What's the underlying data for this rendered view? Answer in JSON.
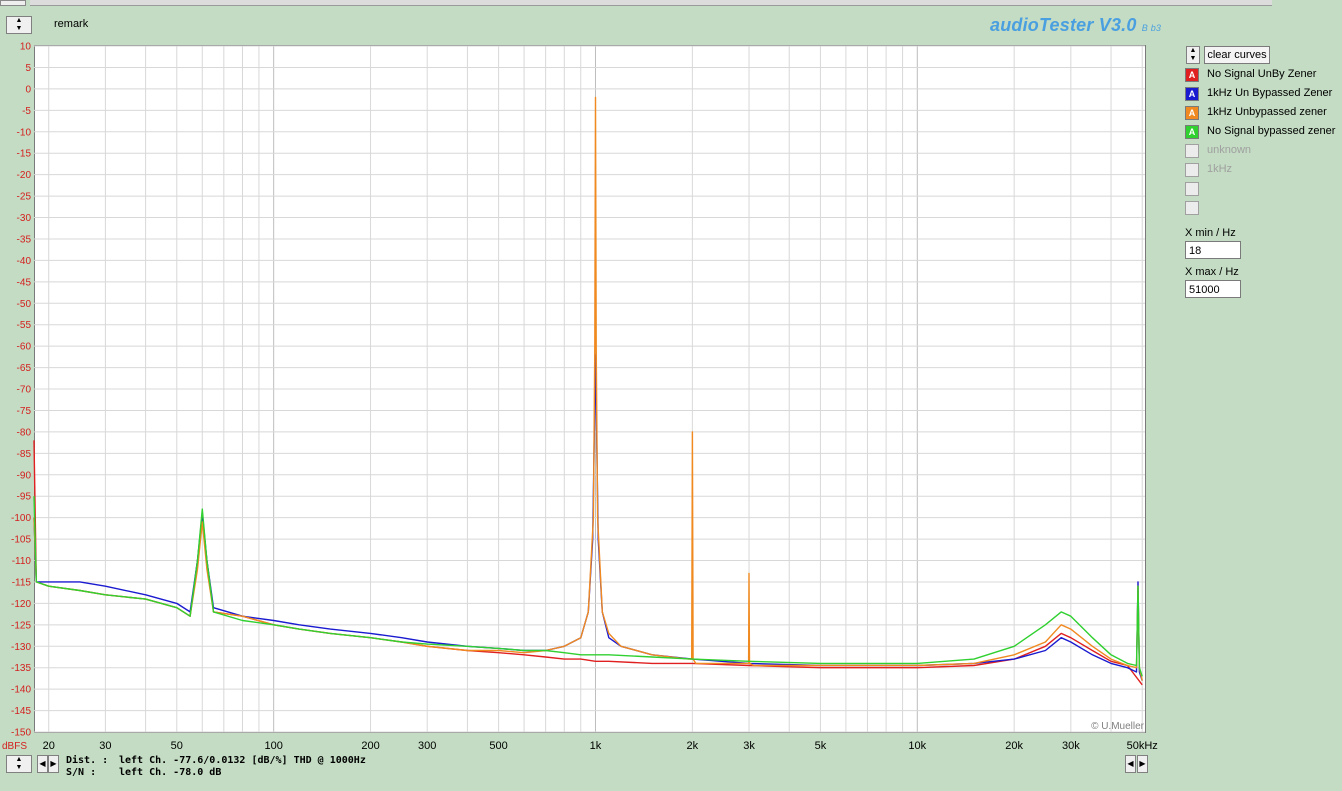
{
  "app": {
    "remark": "remark",
    "brand": "audioTester V3.0",
    "brand_suffix": "B b3",
    "watermark": "© U.Mueller"
  },
  "controls": {
    "clear_label": "clear curves",
    "legend": [
      {
        "label": "No Signal UnBy Zener",
        "color": "#e02020",
        "glyph": "A",
        "active": true
      },
      {
        "label": "1kHz Un Bypassed Zener",
        "color": "#1a1ad0",
        "glyph": "A",
        "active": true
      },
      {
        "label": "1kHz Unbypassed zener",
        "color": "#f08a20",
        "glyph": "A",
        "active": true
      },
      {
        "label": "No Signal bypassed zener",
        "color": "#30d030",
        "glyph": "A",
        "active": true
      },
      {
        "label": "unknown",
        "color": "",
        "glyph": "",
        "active": false
      },
      {
        "label": "1kHz",
        "color": "",
        "glyph": "",
        "active": false
      },
      {
        "label": "",
        "color": "",
        "glyph": "",
        "active": false
      },
      {
        "label": "",
        "color": "",
        "glyph": "",
        "active": false
      }
    ],
    "xmin_label": "X min / Hz",
    "xmin_value": "18",
    "xmax_label": "X max / Hz",
    "xmax_value": "51000"
  },
  "status": {
    "dist_key": "Dist. :",
    "dist_text": "left Ch. -77.6/0.0132 [dB/%] THD @ 1000Hz",
    "sn_key": "S/N :",
    "sn_text": "left Ch. -78.0 dB"
  },
  "chart_data": {
    "type": "line",
    "xscale": "log",
    "xlim": [
      18,
      51000
    ],
    "ylim": [
      -150,
      10
    ],
    "ylabel": "dBFS",
    "grid": true,
    "yticks": [
      "10",
      "5",
      "0",
      "-5",
      "-10",
      "-15",
      "-20",
      "-25",
      "-30",
      "-35",
      "-40",
      "-45",
      "-50",
      "-55",
      "-60",
      "-65",
      "-70",
      "-75",
      "-80",
      "-85",
      "-90",
      "-95",
      "-100",
      "-105",
      "-110",
      "-115",
      "-120",
      "-125",
      "-130",
      "-135",
      "-140",
      "-145",
      "-150"
    ],
    "xticks": [
      {
        "v": 20,
        "t": "20"
      },
      {
        "v": 30,
        "t": "30"
      },
      {
        "v": 50,
        "t": "50"
      },
      {
        "v": 100,
        "t": "100"
      },
      {
        "v": 200,
        "t": "200"
      },
      {
        "v": 300,
        "t": "300"
      },
      {
        "v": 500,
        "t": "500"
      },
      {
        "v": 1000,
        "t": "1k"
      },
      {
        "v": 2000,
        "t": "2k"
      },
      {
        "v": 3000,
        "t": "3k"
      },
      {
        "v": 5000,
        "t": "5k"
      },
      {
        "v": 10000,
        "t": "10k"
      },
      {
        "v": 20000,
        "t": "20k"
      },
      {
        "v": 30000,
        "t": "30k"
      },
      {
        "v": 50000,
        "t": "50kHz"
      }
    ],
    "series": [
      {
        "name": "No Signal UnBy Zener",
        "color": "#e02020",
        "x": [
          18,
          18.3,
          20,
          25,
          30,
          40,
          50,
          55,
          58,
          60,
          62,
          65,
          80,
          100,
          120,
          150,
          200,
          250,
          300,
          400,
          500,
          600,
          700,
          800,
          900,
          1000,
          1100,
          1500,
          2000,
          3000,
          5000,
          7000,
          10000,
          15000,
          20000,
          25000,
          28000,
          30000,
          35000,
          40000,
          45000,
          50000
        ],
        "y": [
          -82,
          -115,
          -116,
          -117,
          -118,
          -119,
          -121,
          -123,
          -110,
          -101,
          -110,
          -122,
          -123,
          -125,
          -126,
          -127,
          -128,
          -129,
          -130,
          -131,
          -131.5,
          -132,
          -132.5,
          -133,
          -133,
          -133.5,
          -133.5,
          -134,
          -134,
          -134.5,
          -135,
          -135,
          -135,
          -134.5,
          -133,
          -130,
          -127,
          -128,
          -131,
          -133.5,
          -134.5,
          -139
        ]
      },
      {
        "name": "1kHz Un Bypassed Zener",
        "color": "#1a1ad0",
        "x": [
          18,
          18.3,
          20,
          25,
          30,
          40,
          50,
          55,
          58,
          60,
          62,
          65,
          80,
          100,
          120,
          150,
          200,
          250,
          300,
          400,
          500,
          600,
          700,
          800,
          900,
          950,
          980,
          1000,
          1020,
          1050,
          1100,
          1200,
          1500,
          2000,
          3000,
          5000,
          7000,
          10000,
          15000,
          20000,
          25000,
          28000,
          30000,
          35000,
          40000,
          45000,
          48000,
          48500,
          49000,
          50000
        ],
        "y": [
          -100,
          -115,
          -115,
          -115,
          -116,
          -118,
          -120,
          -122,
          -110,
          -99,
          -110,
          -121,
          -123,
          -124,
          -125,
          -126,
          -127,
          -128,
          -129,
          -130,
          -130.5,
          -131,
          -131,
          -130,
          -128,
          -122,
          -105,
          -62,
          -105,
          -122,
          -128,
          -130,
          -132,
          -133,
          -134,
          -134.5,
          -134.5,
          -134.5,
          -134,
          -133,
          -131,
          -128,
          -129,
          -132,
          -134,
          -135,
          -136,
          -115,
          -136,
          -138
        ]
      },
      {
        "name": "1kHz Unbypassed zener",
        "color": "#f08a20",
        "x": [
          18,
          18.3,
          20,
          25,
          30,
          40,
          50,
          55,
          58,
          60,
          62,
          65,
          80,
          100,
          120,
          150,
          200,
          250,
          300,
          400,
          500,
          600,
          700,
          800,
          900,
          950,
          985,
          995,
          1000,
          1005,
          1015,
          1050,
          1100,
          1200,
          1500,
          1950,
          1990,
          2000,
          2010,
          2050,
          2900,
          2990,
          3000,
          3010,
          3100,
          5000,
          7000,
          10000,
          15000,
          20000,
          25000,
          28000,
          30000,
          35000,
          40000,
          45000,
          48000,
          48500,
          49000,
          50000
        ],
        "y": [
          -100,
          -115,
          -116,
          -117,
          -118,
          -119,
          -121,
          -123,
          -112,
          -101,
          -112,
          -122,
          -123,
          -125,
          -126,
          -127,
          -128,
          -129,
          -130,
          -131,
          -131,
          -131.5,
          -131,
          -130,
          -128,
          -122,
          -100,
          -60,
          -2,
          -60,
          -100,
          -122,
          -127,
          -130,
          -132,
          -133,
          -133,
          -80,
          -133,
          -134,
          -134,
          -134,
          -113,
          -134,
          -134.5,
          -134.5,
          -134.5,
          -134.5,
          -134,
          -132,
          -129,
          -125,
          -126,
          -130,
          -133,
          -134.5,
          -135,
          -116,
          -135,
          -138
        ]
      },
      {
        "name": "No Signal bypassed zener",
        "color": "#30d030",
        "x": [
          18,
          18.3,
          20,
          25,
          30,
          40,
          50,
          55,
          58,
          60,
          62,
          65,
          80,
          100,
          120,
          150,
          200,
          250,
          300,
          400,
          500,
          600,
          700,
          800,
          900,
          1000,
          1100,
          1500,
          2000,
          3000,
          5000,
          7000,
          10000,
          15000,
          20000,
          25000,
          28000,
          30000,
          35000,
          40000,
          45000,
          48000,
          48500,
          49000,
          50000
        ],
        "y": [
          -95,
          -115,
          -116,
          -117,
          -118,
          -119,
          -121,
          -123,
          -110,
          -98,
          -110,
          -122,
          -124,
          -125,
          -126,
          -127,
          -128,
          -129,
          -129.5,
          -130,
          -130.5,
          -131,
          -131,
          -131.5,
          -132,
          -132,
          -132,
          -132.5,
          -133,
          -133.5,
          -134,
          -134,
          -134,
          -133,
          -130,
          -125,
          -122,
          -123,
          -128,
          -132,
          -134,
          -134.5,
          -116,
          -135,
          -137
        ]
      }
    ]
  }
}
